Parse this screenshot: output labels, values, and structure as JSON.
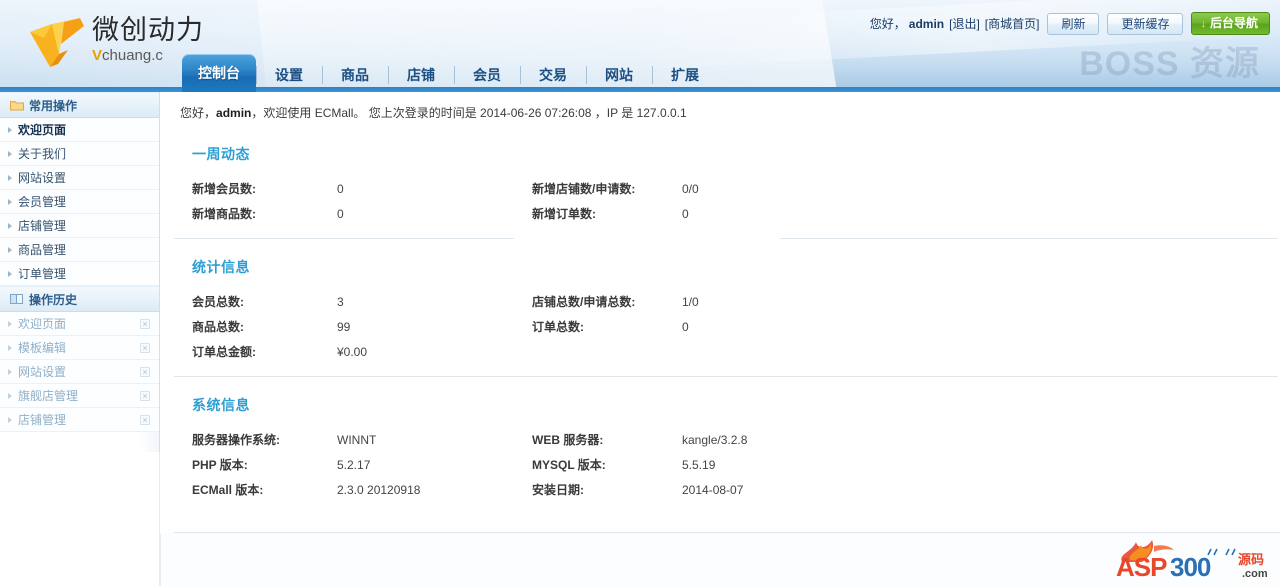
{
  "brand": {
    "name_cn": "微创动力",
    "name_en": "Vchuang.c",
    "watermark": "BOSS 资源"
  },
  "userbar": {
    "greeting": "您好，",
    "username": "admin",
    "logout_label": "[退出]",
    "mall_home_label": "[商城首页]",
    "refresh_label": "刷新",
    "update_cache_label": "更新缓存",
    "nav_label": "后台导航",
    "nav_arrow": "↓"
  },
  "nav": {
    "tabs": [
      {
        "label": "控制台",
        "active": true
      },
      {
        "label": "设置",
        "active": false
      },
      {
        "label": "商品",
        "active": false
      },
      {
        "label": "店铺",
        "active": false
      },
      {
        "label": "会员",
        "active": false
      },
      {
        "label": "交易",
        "active": false
      },
      {
        "label": "网站",
        "active": false
      },
      {
        "label": "扩展",
        "active": false
      }
    ]
  },
  "sidebar": {
    "common_header": "常用操作",
    "common_items": [
      {
        "label": "欢迎页面",
        "selected": true
      },
      {
        "label": "关于我们",
        "selected": false
      },
      {
        "label": "网站设置",
        "selected": false
      },
      {
        "label": "会员管理",
        "selected": false
      },
      {
        "label": "店铺管理",
        "selected": false
      },
      {
        "label": "商品管理",
        "selected": false
      },
      {
        "label": "订单管理",
        "selected": false
      }
    ],
    "history_header": "操作历史",
    "history_items": [
      {
        "label": "欢迎页面",
        "close": "×"
      },
      {
        "label": "模板编辑",
        "close": "×"
      },
      {
        "label": "网站设置",
        "close": "×"
      },
      {
        "label": "旗舰店管理",
        "close": "×"
      },
      {
        "label": "店铺管理",
        "close": "×"
      }
    ]
  },
  "main": {
    "welcome_prefix": "您好，",
    "welcome_user": "admin",
    "welcome_mid": "，欢迎使用 ECMall。  您上次登录的时间是  2014-06-26 07:26:08 ，IP 是  127.0.0.1",
    "sections": [
      {
        "title": "一周动态",
        "left": [
          {
            "key": "新增会员数:",
            "value": "0"
          },
          {
            "key": "新增商品数:",
            "value": "0"
          }
        ],
        "right": [
          {
            "key": "新增店铺数/申请数:",
            "value": "0/0"
          },
          {
            "key": "新增订单数:",
            "value": "0"
          }
        ]
      },
      {
        "title": "统计信息",
        "left": [
          {
            "key": "会员总数:",
            "value": "3"
          },
          {
            "key": "商品总数:",
            "value": "99"
          },
          {
            "key": "订单总金额:",
            "value": "¥0.00"
          }
        ],
        "right": [
          {
            "key": "店铺总数/申请总数:",
            "value": "1/0"
          },
          {
            "key": "订单总数:",
            "value": "0"
          }
        ]
      },
      {
        "title": "系统信息",
        "left": [
          {
            "key": "服务器操作系统:",
            "value": "WINNT"
          },
          {
            "key": "PHP 版本:",
            "value": "5.2.17"
          },
          {
            "key": "ECMall 版本:",
            "value": "2.3.0 20120918"
          }
        ],
        "right": [
          {
            "key": "WEB 服务器:",
            "value": "kangle/3.2.8"
          },
          {
            "key": "MYSQL 版本:",
            "value": "5.5.19"
          },
          {
            "key": "安装日期:",
            "value": "2014-08-07"
          }
        ]
      }
    ]
  },
  "footer_watermark": {
    "text_main": "ASP300",
    "text_cn": "源码",
    "text_com": ".com"
  },
  "colors": {
    "accent_blue": "#2e9fd4",
    "tab_active": "#1a6cb2",
    "green_button": "#6fb52f",
    "logo_orange": "#f5a623"
  }
}
